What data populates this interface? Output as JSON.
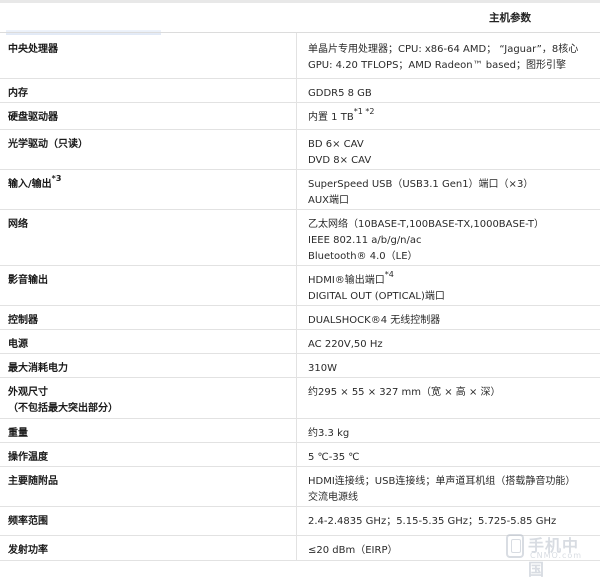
{
  "header": {
    "title": "主机参数"
  },
  "rows": [
    {
      "label": "中央处理器",
      "value_lines": [
        "单晶片专用处理器；CPU: x86-64 AMD； “Jaguar”，8核心",
        "GPU: 4.20 TFLOPS；AMD Radeon™ based；图形引擎"
      ]
    },
    {
      "label": "内存",
      "value_lines": [
        "GDDR5 8 GB"
      ]
    },
    {
      "label": "硬盘驱动器",
      "value_lines": [
        "内置 1 TB"
      ],
      "value_sup": "*1 *2"
    },
    {
      "label": "光学驱动（只读）",
      "value_lines": [
        "BD 6× CAV",
        "DVD 8× CAV"
      ]
    },
    {
      "label": "输入/输出",
      "label_sup": "*3",
      "value_lines": [
        "SuperSpeed USB（USB3.1 Gen1）端口（×3）",
        "AUX端口"
      ]
    },
    {
      "label": "网络",
      "value_lines": [
        "乙太网络（10BASE-T,100BASE-TX,1000BASE-T）",
        "IEEE 802.11 a/b/g/n/ac",
        "Bluetooth® 4.0（LE）"
      ]
    },
    {
      "label": "影音输出",
      "value_lines": [
        "HDMI®输出端口",
        "DIGITAL OUT (OPTICAL)端口"
      ],
      "value_sup": "*4"
    },
    {
      "label": "控制器",
      "value_lines": [
        "DUALSHOCK®4 无线控制器"
      ]
    },
    {
      "label": "电源",
      "value_lines": [
        "AC 220V,50 Hz"
      ]
    },
    {
      "label": "最大消耗电力",
      "value_lines": [
        "310W"
      ]
    },
    {
      "label": "外观尺寸",
      "label_line2": "（不包括最大突出部分）",
      "value_lines": [
        "约295 × 55 × 327 mm（宽 × 高 × 深）"
      ]
    },
    {
      "label": "重量",
      "value_lines": [
        "约3.3 kg"
      ]
    },
    {
      "label": "操作温度",
      "value_lines": [
        "5 ℃-35 ℃"
      ]
    },
    {
      "label": "主要随附品",
      "value_lines": [
        "HDMI连接线；USB连接线；单声道耳机组（搭载静音功能）",
        "交流电源线"
      ]
    },
    {
      "label": "频率范围",
      "value_lines": [
        "2.4-2.4835 GHz；5.15-5.35 GHz；5.725-5.85 GHz"
      ]
    },
    {
      "label": "发射功率",
      "value_lines": [
        "≤20 dBm（EIRP）"
      ]
    }
  ],
  "watermark": {
    "text": "手机中国",
    "sub": "CNMO.com"
  }
}
